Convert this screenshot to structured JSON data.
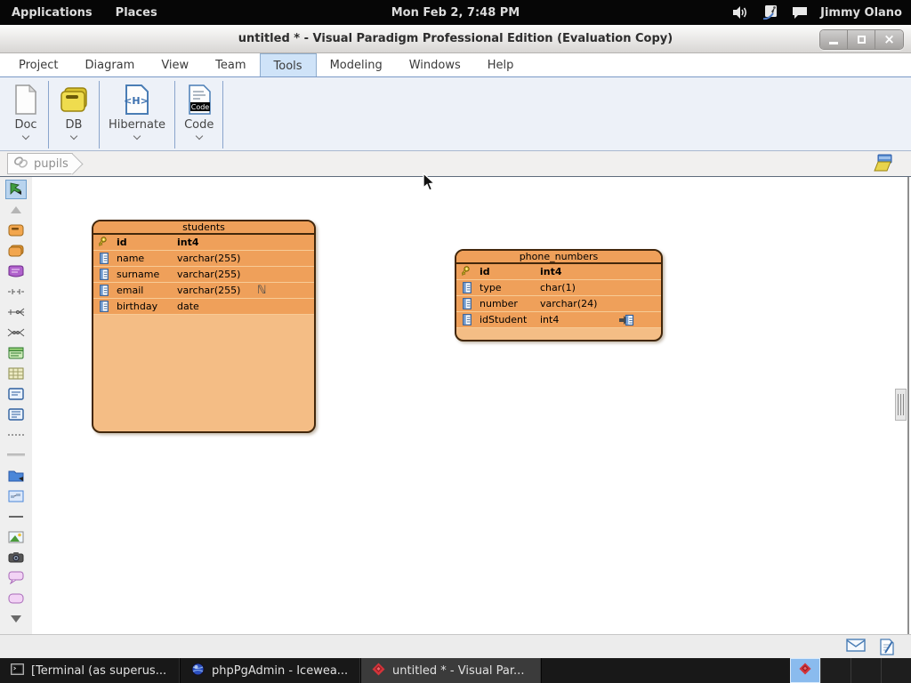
{
  "gnome_bar": {
    "applications_label": "Applications",
    "places_label": "Places",
    "clock": "Mon Feb 2, 7:48 PM",
    "username": "Jimmy Olano",
    "icons": [
      "volume-icon",
      "stylus-input-icon",
      "chat-icon"
    ]
  },
  "window": {
    "title": "untitled * - Visual Paradigm Professional Edition (Evaluation Copy)",
    "controls": [
      "minimize",
      "maximize",
      "close"
    ]
  },
  "menubar": {
    "items": [
      "Project",
      "Diagram",
      "View",
      "Team",
      "Tools",
      "Modeling",
      "Windows",
      "Help"
    ],
    "active_item": "Tools"
  },
  "toolbar": {
    "buttons": [
      {
        "label": "Doc",
        "icon": "document-icon"
      },
      {
        "label": "DB",
        "icon": "database-icon"
      },
      {
        "label": "Hibernate",
        "icon": "hibernate-icon"
      },
      {
        "label": "Code",
        "icon": "code-icon"
      }
    ]
  },
  "breadcrumb": {
    "diagram_name": "pupils",
    "icons": [
      "link-icon",
      "open-folder-icon"
    ]
  },
  "palette": {
    "selected_tool": "cursor-tool",
    "tools": [
      "cursor-tool",
      "scroll-up",
      "entity",
      "entity-alt",
      "view",
      "relationship-dashed",
      "one-to-many-relationship",
      "many-to-many-relationship",
      "stored-procedure-table",
      "grid-table",
      "note",
      "note-alt",
      "package-folder",
      "diagram-overview",
      "image",
      "screenshot-camera",
      "callout",
      "rounded-rectangle",
      "scroll-down"
    ]
  },
  "diagram": {
    "entities": [
      {
        "name": "students",
        "columns": [
          {
            "icon": "primary-key-icon",
            "name": "id",
            "type": "int4"
          },
          {
            "icon": "column-icon",
            "name": "name",
            "type": "varchar(255)"
          },
          {
            "icon": "column-icon",
            "name": "surname",
            "type": "varchar(255)"
          },
          {
            "icon": "column-icon",
            "name": "email",
            "type": "varchar(255)",
            "nullable_marker": "ℕ"
          },
          {
            "icon": "column-icon",
            "name": "birthday",
            "type": "date"
          }
        ]
      },
      {
        "name": "phone_numbers",
        "columns": [
          {
            "icon": "primary-key-icon",
            "name": "id",
            "type": "int4"
          },
          {
            "icon": "column-icon",
            "name": "type",
            "type": "char(1)"
          },
          {
            "icon": "column-icon",
            "name": "number",
            "type": "varchar(24)"
          },
          {
            "icon": "column-icon",
            "name": "idStudent",
            "type": "int4",
            "foreign_key": true
          }
        ]
      }
    ]
  },
  "statusbar": {
    "icons": [
      "message-icon",
      "log-edit-icon"
    ]
  },
  "taskbar": {
    "items": [
      {
        "icon": "terminal-icon",
        "label": "[Terminal (as superus...",
        "active": false
      },
      {
        "icon": "browser-globe-icon",
        "label": "phpPgAdmin - Icewea...",
        "active": false
      },
      {
        "icon": "visual-paradigm-icon",
        "label": "untitled * - Visual Par...",
        "active": true
      }
    ],
    "workspaces": {
      "count": 4,
      "active_index": 0
    }
  },
  "colors": {
    "entity_header": "#efa05a",
    "entity_body": "#f4bd85",
    "entity_border": "#42270b",
    "menu_active_bg": "#cfe3f8",
    "toolbar_bg": "#edf1f8",
    "taskbar_active_bg": "#3b3b3b",
    "workspace_active_bg": "#8abbee"
  }
}
